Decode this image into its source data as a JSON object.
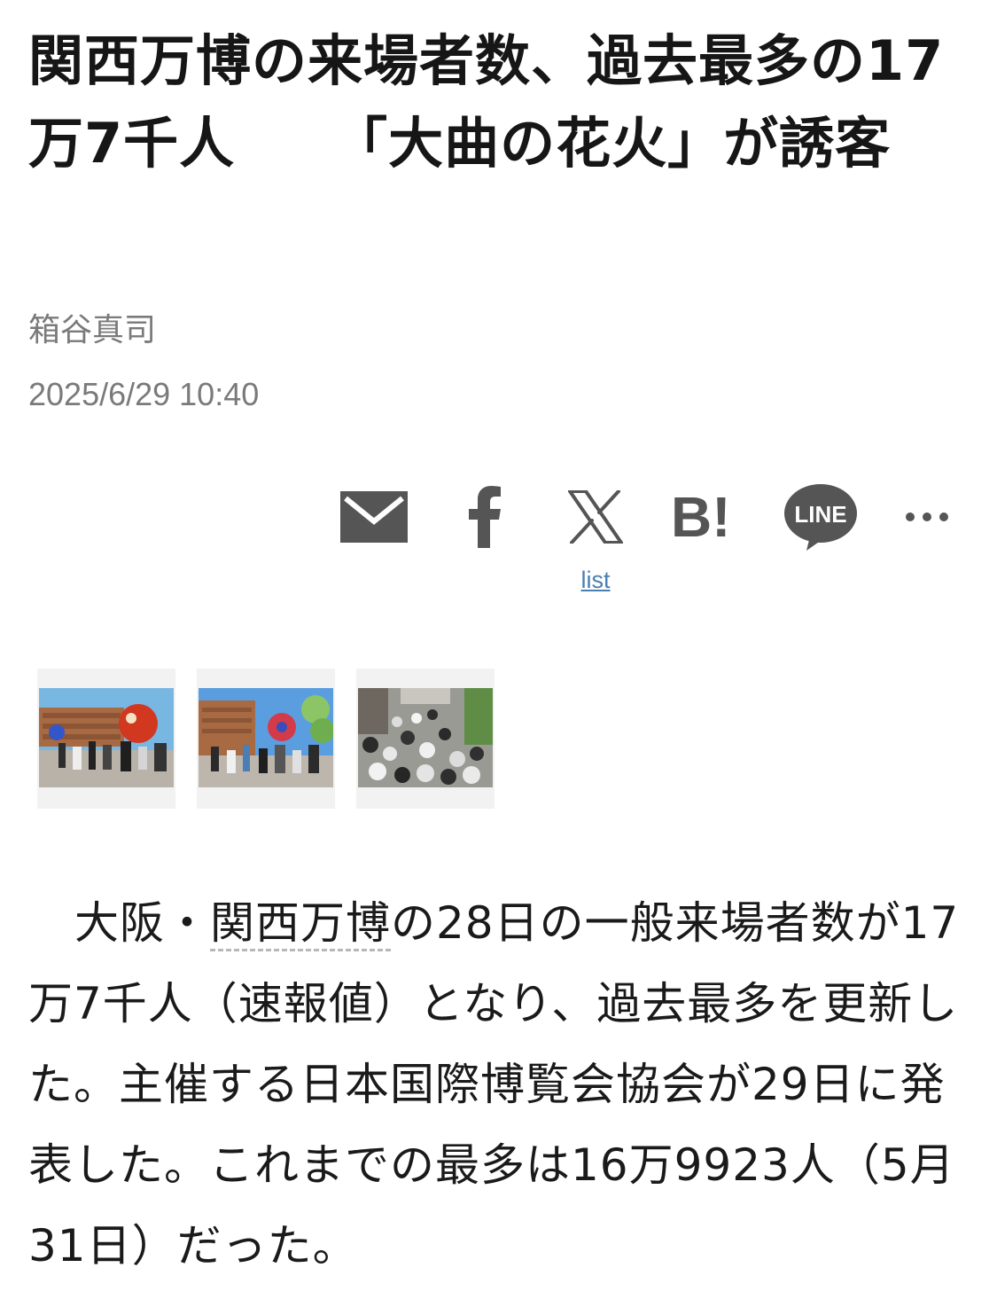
{
  "article": {
    "title_line1": "関西万博の来場者数、過去最多の17万7千人",
    "title_line2": "「大曲の花火」が誘客",
    "author": "箱谷真司",
    "date": "2025/6/29 10:40"
  },
  "share": {
    "icons": [
      "mail-icon",
      "facebook-icon",
      "x-icon",
      "hatena-bookmark-icon",
      "line-icon",
      "more-icon"
    ],
    "hatena_label": "B!",
    "line_label": "LINE",
    "list_label": "list"
  },
  "photos": {
    "count": 3,
    "captions": []
  },
  "body": {
    "p1_pre": "大阪・",
    "p1_keyword": "関西万博",
    "p1_post": "の28日の一般来場者数が17万7千人（速報値）となり、過去最多を更新した。主催する日本国際博覧会協会が29日に発表した。これまでの最多は16万9923人（5月31日）だった。"
  },
  "colors": {
    "text": "#161616",
    "meta": "#7a7a7a",
    "icon": "#555555",
    "link": "#4a7fb0"
  }
}
